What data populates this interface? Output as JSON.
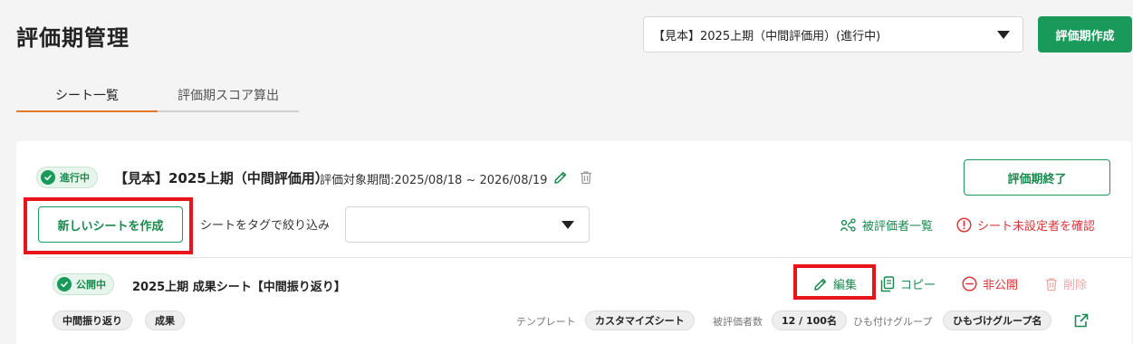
{
  "page": {
    "title": "評価期管理"
  },
  "header": {
    "period_select_value": "【見本】2025上期（中間評価用）(進行中)",
    "create_period_label": "評価期作成"
  },
  "tabs": [
    {
      "label": "シート一覧",
      "active": true
    },
    {
      "label": "評価期スコア算出",
      "active": false
    }
  ],
  "period": {
    "status": "進行中",
    "name": "【見本】2025上期（中間評価用）",
    "range_label": "評価対象期間:2025/08/18 ~ 2026/08/19",
    "end_label": "評価期終了",
    "new_sheet_label": "新しいシートを作成",
    "filter_label": "シートをタグで絞り込み",
    "filter_value": "",
    "evaluatees_link": "被評価者一覧",
    "unset_link": "シート未設定者を確認"
  },
  "sheet": {
    "status": "公開中",
    "title": "2025上期 成果シート【中間振り返り】",
    "actions": {
      "edit": "編集",
      "copy": "コピー",
      "unpublish": "非公開",
      "delete": "削除"
    },
    "tags": [
      "中間振り返り",
      "成果"
    ],
    "template_label": "テンプレート",
    "template_value": "カスタマイズシート",
    "evaluatee_count_label": "被評価者数",
    "evaluatee_count_value": "12 / 100名",
    "group_label": "ひも付けグループ",
    "group_value": "ひもづけグループ名"
  },
  "colors": {
    "brand_green": "#1a9a5a",
    "danger_red": "#d9383b",
    "highlight_red": "#e8141c",
    "tab_accent": "#e07a2a"
  }
}
